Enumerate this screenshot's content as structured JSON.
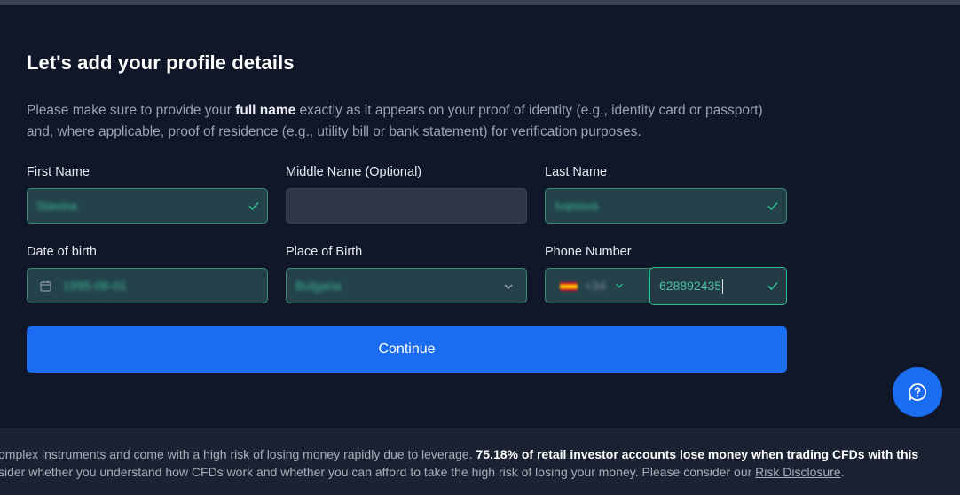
{
  "page": {
    "title": "Let's add your profile details",
    "description": {
      "part1": "Please make sure to provide your ",
      "bold": "full name",
      "part2": " exactly as it appears on your proof of identity (e.g., identity card or passport) and, where applicable, proof of residence (e.g., utility bill or bank statement) for verification purposes."
    }
  },
  "form": {
    "first_name": {
      "label": "First Name",
      "value": "Slavina",
      "status": "valid"
    },
    "middle_name": {
      "label": "Middle Name (Optional)",
      "value": ""
    },
    "last_name": {
      "label": "Last Name",
      "value": "Ivanova",
      "status": "valid"
    },
    "date_of_birth": {
      "label": "Date of birth",
      "value": "1995-08-01",
      "icon": "calendar-icon"
    },
    "place_of_birth": {
      "label": "Place of Birth",
      "value": "Bulgaria",
      "icon": "chevron-down-icon"
    },
    "phone": {
      "label": "Phone Number",
      "country_code": "+34",
      "flag": "spain-flag",
      "number": "628892435",
      "status": "valid"
    },
    "continue_label": "Continue"
  },
  "help_button": {
    "icon": "chat-help-icon"
  },
  "footer": {
    "line1_prefix": "omplex instruments and come with a high risk of losing money rapidly due to leverage. ",
    "line1_bold": "75.18% of retail investor accounts lose money when trading CFDs with this",
    "line2_prefix": "sider whether you understand how CFDs work and whether you can afford to take the high risk of losing your money. Please consider our ",
    "line2_link": "Risk Disclosure",
    "line2_suffix": "."
  },
  "colors": {
    "background": "#0f1729",
    "accent": "#1a6cf0",
    "valid": "#2fbf8f",
    "field": "#2d3748"
  }
}
